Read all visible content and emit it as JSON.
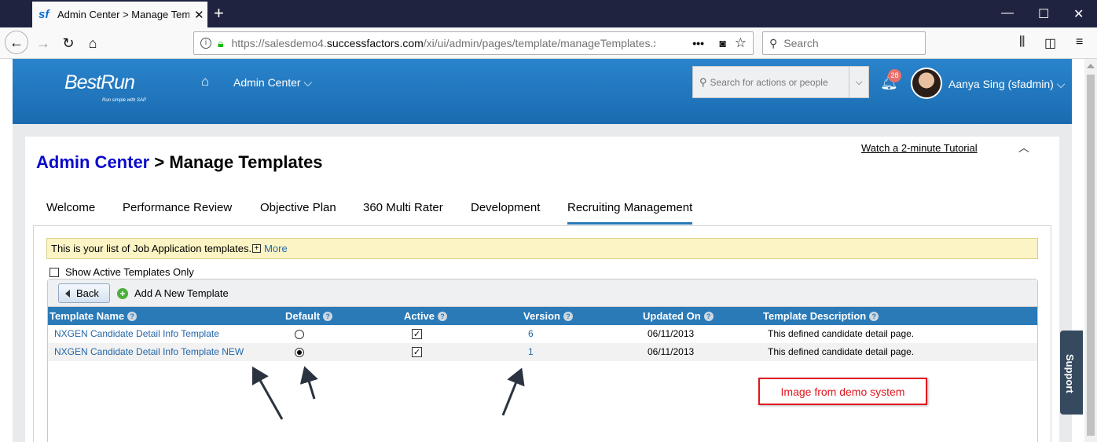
{
  "browser": {
    "tab_title": "Admin Center > Manage Temp",
    "favicon_text": "sf",
    "url_host": "https://salesdemo4.",
    "url_domain": "successfactors.com",
    "url_path": "/xi/ui/admin/pages/template/manageTemplates.xht",
    "search_placeholder": "Search",
    "icons": [
      "back-arrow-icon",
      "forward-arrow-icon",
      "reload-icon",
      "home-icon",
      "info-icon",
      "lock-icon",
      "more-icon",
      "pocket-icon",
      "bookmark-star-icon",
      "library-icon",
      "sidebar-icon",
      "menu-icon"
    ]
  },
  "header": {
    "logo_text": "BestRun",
    "logo_tagline": "Run simple with SAP",
    "nav_label": "Admin Center",
    "search_placeholder": "Search for actions or people",
    "notification_count": "28",
    "user_name": "Aanya Sing (sfadmin)",
    "brand_color": "#1f75bd"
  },
  "page": {
    "tutorial_link": "Watch a 2-minute Tutorial",
    "breadcrumb_link": "Admin Center",
    "title_separator": " > ",
    "title": "Manage Templates",
    "tabs": [
      {
        "label": "Welcome",
        "active": false
      },
      {
        "label": "Performance Review",
        "active": false
      },
      {
        "label": "Objective Plan",
        "active": false
      },
      {
        "label": "360 Multi Rater",
        "active": false
      },
      {
        "label": "Development",
        "active": false
      },
      {
        "label": "Recruiting Management",
        "active": true
      }
    ],
    "info_text": "This is your list of Job Application templates.",
    "info_more": "More",
    "active_only_label": "Show Active Templates Only",
    "back_label": "Back",
    "add_label": "Add A New Template"
  },
  "table": {
    "header_color": "#2a7ab8",
    "columns": [
      "Template Name",
      "Default",
      "Active",
      "Version",
      "Updated On",
      "Template Description"
    ],
    "rows": [
      {
        "name": "NXGEN Candidate Detail Info Template",
        "default": false,
        "active": true,
        "version": "6",
        "updated_on": "06/11/2013",
        "description": "This defined candidate detail page."
      },
      {
        "name": "NXGEN Candidate Detail Info Template NEW",
        "default": true,
        "active": true,
        "version": "1",
        "updated_on": "06/11/2013",
        "description": "This defined candidate detail page."
      }
    ]
  },
  "annotation": {
    "label": "Image from demo system",
    "color": "#e0171f"
  },
  "support_label": "Support"
}
